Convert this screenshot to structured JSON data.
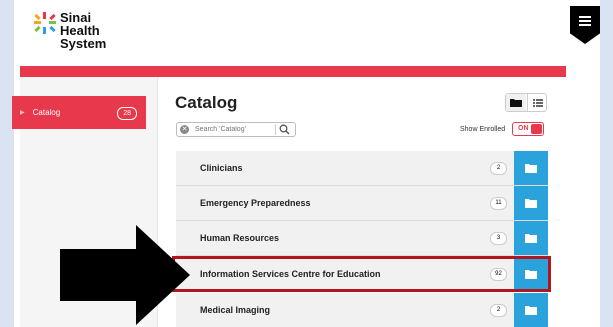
{
  "brand": {
    "lines": [
      "Sinai",
      "Health",
      "System"
    ]
  },
  "sidebar": {
    "items": [
      {
        "label": "Catalog",
        "count": "28"
      }
    ]
  },
  "main": {
    "title": "Catalog",
    "search": {
      "placeholder": "Search 'Catalog'"
    },
    "show_enrolled": {
      "label": "Show Enrolled",
      "state": "ON"
    },
    "rows": [
      {
        "title": "Clinicians",
        "count": "2"
      },
      {
        "title": "Emergency Preparedness",
        "count": "11"
      },
      {
        "title": "Human Resources",
        "count": "3"
      },
      {
        "title": "Information Services Centre for Education",
        "count": "92"
      },
      {
        "title": "Medical Imaging",
        "count": "2"
      }
    ]
  },
  "colors": {
    "accent": "#e8384b",
    "folder_button": "#2aa3dd",
    "highlight": "#b0161f"
  },
  "icons": {
    "menu": "hamburger-icon",
    "folder": "folder-icon",
    "list": "list-icon",
    "search": "magnifier-icon",
    "clear": "clear-icon"
  }
}
